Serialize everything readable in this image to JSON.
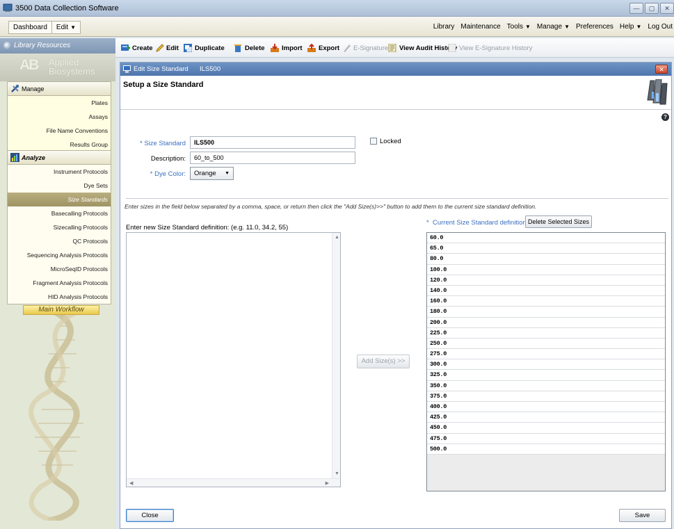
{
  "window": {
    "title": "3500 Data Collection Software",
    "controls": [
      "—",
      "▢",
      "✕"
    ]
  },
  "menubar": {
    "tabs": [
      "Dashboard",
      "Edit"
    ],
    "right": [
      {
        "label": "Library",
        "dropdown": false
      },
      {
        "label": "Maintenance",
        "dropdown": false
      },
      {
        "label": "Tools",
        "dropdown": true
      },
      {
        "label": "Manage",
        "dropdown": true
      },
      {
        "label": "Preferences",
        "dropdown": false
      },
      {
        "label": "Help",
        "dropdown": true
      },
      {
        "label": "Log Out",
        "dropdown": false
      }
    ]
  },
  "sidebar": {
    "header": "Library Resources",
    "brand": {
      "logo": "AB",
      "line1": "Applied",
      "line2": "Biosystems"
    },
    "manage": {
      "title": "Manage",
      "items": [
        "Plates",
        "Assays",
        "File Name Conventions",
        "Results Group"
      ]
    },
    "analyze": {
      "title": "Analyze",
      "items": [
        "Instrument Protocols",
        "Dye Sets",
        "Size Standards",
        "Basecalling Protocols",
        "Sizecalling Protocols",
        "QC Protocols",
        "Sequencing Analysis Protocols",
        "MicroSeqID Protocols",
        "Fragment Analysis Protocols",
        "HID Analysis Protocols"
      ],
      "active": "Size Standards"
    },
    "workflow": "Main Workflow"
  },
  "toolbar": {
    "items": [
      {
        "label": "Create",
        "icon": "create-icon",
        "enabled": true
      },
      {
        "label": "Edit",
        "icon": "pencil-icon",
        "enabled": true
      },
      {
        "label": "Duplicate",
        "icon": "duplicate-icon",
        "enabled": true
      },
      {
        "label": "Delete",
        "icon": "trash-icon",
        "enabled": true
      },
      {
        "label": "Import",
        "icon": "import-icon",
        "enabled": true
      },
      {
        "label": "Export",
        "icon": "export-icon",
        "enabled": true
      },
      {
        "label": "E-Signature",
        "icon": "signature-icon",
        "enabled": false
      },
      {
        "label": "View Audit History",
        "icon": "audit-icon",
        "enabled": true
      },
      {
        "label": "View E-Signature History",
        "icon": "signature-history-icon",
        "enabled": false
      }
    ]
  },
  "editor": {
    "window_title": "Edit Size Standard",
    "window_name": "ILS500",
    "heading": "Setup a Size Standard",
    "size_standard_label": "Size Standard",
    "size_standard_value": "ILS500",
    "locked_label": "Locked",
    "description_label": "Description:",
    "description_value": "60_to_500",
    "dye_color_label": "Dye Color:",
    "dye_color_value": "Orange",
    "required_marker": "*",
    "instructions": "Enter sizes in the field below separated by a comma, space, or return then click the \"Add Size(s)>>\" button to add them to the current size standard definition.",
    "new_def_label": "Enter new Size Standard definition: (e.g. 11.0, 34.2, 55)",
    "current_def_label": "Current Size Standard definition:",
    "delete_button": "Delete Selected Sizes",
    "add_button": "Add Size(s) >>",
    "sizes": [
      "60.0",
      "65.0",
      "80.0",
      "100.0",
      "120.0",
      "140.0",
      "160.0",
      "180.0",
      "200.0",
      "225.0",
      "250.0",
      "275.0",
      "300.0",
      "325.0",
      "350.0",
      "375.0",
      "400.0",
      "425.0",
      "450.0",
      "475.0",
      "500.0"
    ],
    "close_button": "Close",
    "save_button": "Save",
    "help": "?"
  },
  "colors": {
    "accent": "#3a6fc0",
    "title_bar": "#4f76ad",
    "active_item": "#9f9463"
  }
}
